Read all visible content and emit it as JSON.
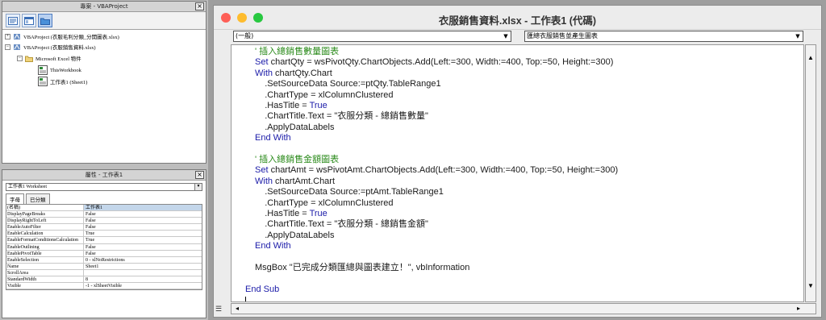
{
  "project_pane": {
    "title": "專案 - VBAProject",
    "tree": [
      {
        "label": "VBAProject (衣服毛利分類_分開圖表.xlsx)"
      },
      {
        "label": "VBAProject (衣服銷售資料.xlsx)"
      },
      {
        "label": "Microsoft Excel 物件"
      },
      {
        "label": "ThisWorkbook"
      },
      {
        "label": "工作表1 (Sheet1)"
      }
    ]
  },
  "properties_pane": {
    "title": "屬性 - 工作表1",
    "object_combo": "工作表1 Worksheet",
    "tabs": [
      "字母",
      "已分類"
    ],
    "rows": [
      {
        "name": "(名稱)",
        "value": "工作表1"
      },
      {
        "name": "DisplayPageBreaks",
        "value": "False"
      },
      {
        "name": "DisplayRightToLeft",
        "value": "False"
      },
      {
        "name": "EnableAutoFilter",
        "value": "False"
      },
      {
        "name": "EnableCalculation",
        "value": "True"
      },
      {
        "name": "EnableFormatConditionsCalculation",
        "value": "True"
      },
      {
        "name": "EnableOutlining",
        "value": "False"
      },
      {
        "name": "EnablePivotTable",
        "value": "False"
      },
      {
        "name": "EnableSelection",
        "value": "0 - xlNoRestrictions"
      },
      {
        "name": "Name",
        "value": "Sheet1"
      },
      {
        "name": "ScrollArea",
        "value": ""
      },
      {
        "name": "StandardWidth",
        "value": "8"
      },
      {
        "name": "Visible",
        "value": "-1 - xlSheetVisible"
      }
    ]
  },
  "code_window": {
    "title": "衣服銷售資料.xlsx - 工作表1 (代碼)",
    "object_dropdown": "(一般)",
    "proc_dropdown": "匯總衣服銷售並產生圖表",
    "traffic_colors": [
      "#fe5f57",
      "#febc2e",
      "#28c840"
    ],
    "lines": [
      {
        "text": "' 插入總銷售數量圖表",
        "style": "cmt"
      },
      {
        "text": "Set chartQty = wsPivotQty.ChartObjects.Add(Left:=300, Width:=400, Top:=50, Height:=300)",
        "style": "mix",
        "kw": "Set"
      },
      {
        "text": "With chartQty.Chart",
        "style": "mix",
        "kw": "With"
      },
      {
        "text": "    .SetSourceData Source:=ptQty.TableRange1",
        "style": "plain"
      },
      {
        "text": "    .ChartType = xlColumnClustered",
        "style": "plain"
      },
      {
        "text": "    .HasTitle = True",
        "style": "truek"
      },
      {
        "text": "    .ChartTitle.Text = \"衣服分類 - 總銷售數量\"",
        "style": "plain"
      },
      {
        "text": "    .ApplyDataLabels",
        "style": "plain"
      },
      {
        "text": "End With",
        "style": "kwline"
      },
      {
        "text": "",
        "style": "plain"
      },
      {
        "text": "' 插入總銷售金額圖表",
        "style": "cmt"
      },
      {
        "text": "Set chartAmt = wsPivotAmt.ChartObjects.Add(Left:=300, Width:=400, Top:=50, Height:=300)",
        "style": "mix",
        "kw": "Set"
      },
      {
        "text": "With chartAmt.Chart",
        "style": "mix",
        "kw": "With"
      },
      {
        "text": "    .SetSourceData Source:=ptAmt.TableRange1",
        "style": "plain"
      },
      {
        "text": "    .ChartType = xlColumnClustered",
        "style": "plain"
      },
      {
        "text": "    .HasTitle = True",
        "style": "truek"
      },
      {
        "text": "    .ChartTitle.Text = \"衣服分類 - 總銷售金額\"",
        "style": "plain"
      },
      {
        "text": "    .ApplyDataLabels",
        "style": "plain"
      },
      {
        "text": "End With",
        "style": "kwline"
      },
      {
        "text": "",
        "style": "plain"
      },
      {
        "text": "MsgBox \"已完成分類匯總與圖表建立！\", vbInformation",
        "style": "plain"
      },
      {
        "text": "",
        "style": "plain"
      },
      {
        "text": "End Sub",
        "style": "kwline-out"
      }
    ]
  }
}
